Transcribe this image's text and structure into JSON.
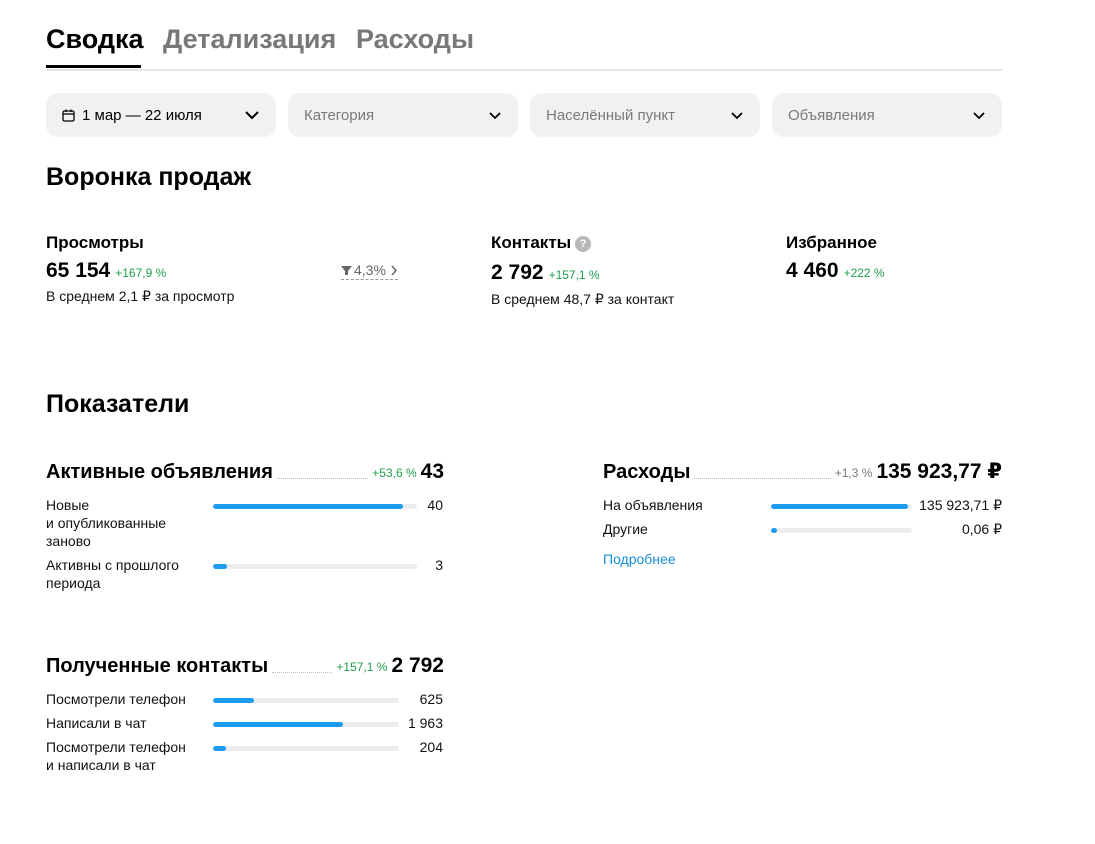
{
  "tabs": [
    {
      "label": "Сводка",
      "active": true
    },
    {
      "label": "Детализация",
      "active": false
    },
    {
      "label": "Расходы",
      "active": false
    }
  ],
  "filters": {
    "date": {
      "value": "1 мар — 22 июля",
      "icon": "calendar-icon"
    },
    "category": {
      "placeholder": "Категория"
    },
    "location": {
      "placeholder": "Населённый пункт"
    },
    "ads": {
      "placeholder": "Объявления"
    }
  },
  "funnel": {
    "title": "Воронка продаж",
    "views": {
      "label": "Просмотры",
      "value": "65 154",
      "change": "+167,9 %",
      "sub": "В среднем 2,1 ₽ за просмотр"
    },
    "conversion": "4,3%",
    "contacts": {
      "label": "Контакты",
      "help": "?",
      "value": "2 792",
      "change": "+157,1 %",
      "sub": "В среднем 48,7 ₽ за контакт"
    },
    "favorites": {
      "label": "Избранное",
      "value": "4 460",
      "change": "+222 %"
    }
  },
  "indicators": {
    "title": "Показатели",
    "active_ads": {
      "title": "Активные объявления",
      "change": "+53,6 %",
      "total": "43",
      "rows": [
        {
          "label_lines": [
            "Новые",
            "и опубликованные",
            "заново"
          ],
          "value": "40",
          "fraction": 0.93
        },
        {
          "label_lines": [
            "Активны с прошлого",
            "периода"
          ],
          "value": "3",
          "fraction": 0.07
        }
      ]
    },
    "expenses": {
      "title": "Расходы",
      "change": "+1,3 %",
      "total": "135 923,77 ₽",
      "rows": [
        {
          "label": "На объявления",
          "value": "135 923,71 ₽",
          "fraction": 0.97
        },
        {
          "label": "Другие",
          "value": "0,06 ₽",
          "fraction": 0.04
        }
      ],
      "more_link": "Подробнее"
    },
    "contacts_received": {
      "title": "Полученные контакты",
      "change": "+157,1 %",
      "total": "2 792",
      "rows": [
        {
          "label_lines": [
            "Посмотрели телефон"
          ],
          "value": "625",
          "fraction": 0.22
        },
        {
          "label_lines": [
            "Написали в чат"
          ],
          "value": "1 963",
          "fraction": 0.7
        },
        {
          "label_lines": [
            "Посмотрели телефон",
            "и написали в чат"
          ],
          "value": "204",
          "fraction": 0.07
        }
      ]
    }
  },
  "colors": {
    "accent": "#1d9bf0",
    "positive": "#1e9e4a",
    "filter_bg": "#f2f1f0",
    "link": "#1a8fdb"
  }
}
